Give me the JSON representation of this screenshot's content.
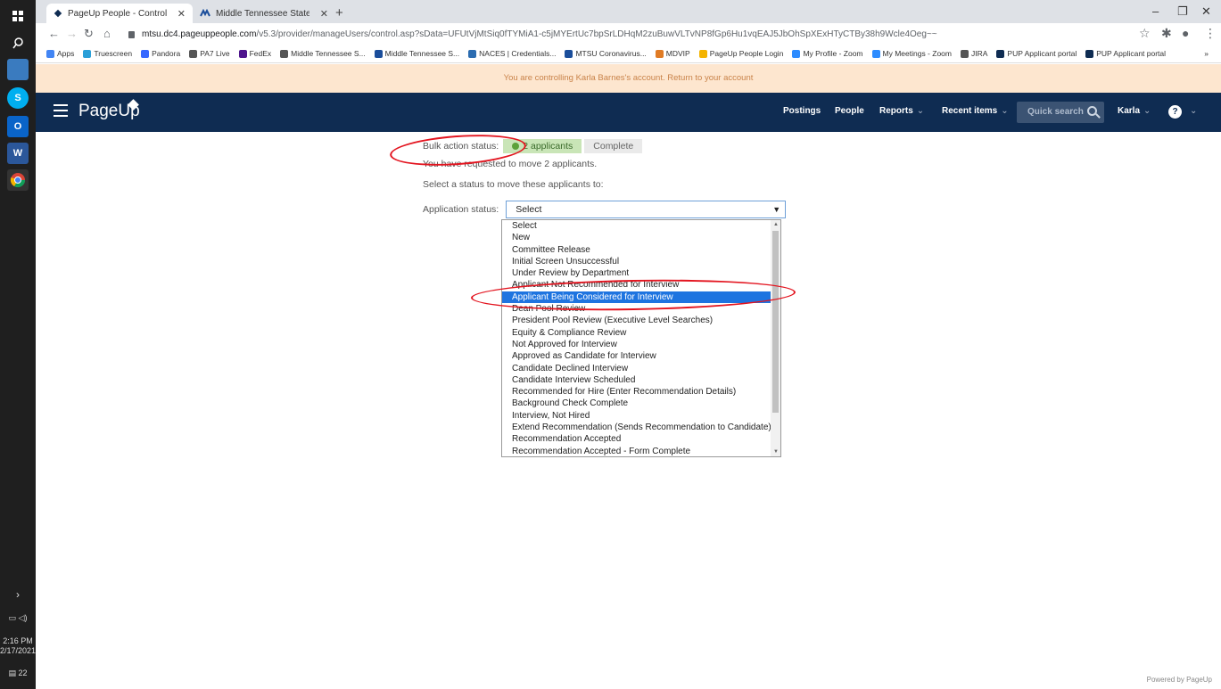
{
  "taskbar": {
    "time": "2:16 PM",
    "date": "2/17/2021",
    "notifications": "22"
  },
  "browser": {
    "tabs": [
      {
        "title": "PageUp People - Control"
      },
      {
        "title": "Middle Tennessee State Universit"
      }
    ],
    "url_host": "mtsu.dc4.pageuppeople.com",
    "url_path": "/v5.3/provider/manageUsers/control.asp?sData=UFUtVjMtSiq0fTYMiA1-c5jMYErtUc7bpSrLDHqM2zuBuwVLTvNP8fGp6Hu1vqEAJ5JbOhSpXExHTyCTBy38h9Wcle4Oeg~~",
    "bookmarks": [
      {
        "label": "Apps",
        "color": "#4285f4"
      },
      {
        "label": "Truescreen",
        "color": "#2a9fd8"
      },
      {
        "label": "Pandora",
        "color": "#3668ff"
      },
      {
        "label": "PA7 Live",
        "color": "#555555"
      },
      {
        "label": "FedEx",
        "color": "#4d148c"
      },
      {
        "label": "Middle Tennessee S...",
        "color": "#555555"
      },
      {
        "label": "Middle Tennessee S...",
        "color": "#1b4e9b"
      },
      {
        "label": "NACES | Credentials...",
        "color": "#2b6cb0"
      },
      {
        "label": "MTSU Coronavirus...",
        "color": "#1b4e9b"
      },
      {
        "label": "MDVIP",
        "color": "#e07b24"
      },
      {
        "label": "PageUp People Login",
        "color": "#f4b400"
      },
      {
        "label": "My Profile - Zoom",
        "color": "#2d8cff"
      },
      {
        "label": "My Meetings - Zoom",
        "color": "#2d8cff"
      },
      {
        "label": "JIRA",
        "color": "#555555"
      },
      {
        "label": "PUP Applicant portal",
        "color": "#0f2c52"
      },
      {
        "label": "PUP Applicant portal",
        "color": "#0f2c52"
      }
    ]
  },
  "banner": {
    "text": "You are controlling Karla Barnes's account.",
    "link": "Return to your account"
  },
  "appbar": {
    "logo": "PageUp",
    "nav": [
      {
        "label": "Postings"
      },
      {
        "label": "People"
      },
      {
        "label": "Reports",
        "chevron": "⌄"
      },
      {
        "label": "Recent items",
        "chevron": "⌄"
      }
    ],
    "quick_search": "Quick search",
    "user": "Karla",
    "help": "?"
  },
  "bulk": {
    "label": "Bulk action status:",
    "step_done": "2 applicants",
    "step_next": "Complete",
    "requested": "You have requested to move 2 applicants.",
    "instruction": "Select a status to move these applicants to:",
    "status_label": "Application status:",
    "selected_value": "Select"
  },
  "dropdown_options": [
    "Select",
    "New",
    "Committee Release",
    "Initial Screen Unsuccessful",
    "Under Review by Department",
    "Applicant Not Recommended for Interview",
    "Applicant Being Considered for Interview",
    "Dean Pool Review",
    "President Pool Review (Executive Level Searches)",
    "Equity & Compliance Review",
    "Not Approved for Interview",
    "Approved as Candidate for Interview",
    "Candidate Declined Interview",
    "Candidate Interview Scheduled",
    "Recommended for Hire (Enter Recommendation Details)",
    "Background Check Complete",
    "Interview, Not Hired",
    "Extend Recommendation (Sends Recommendation to Candidate)",
    "Recommendation Accepted",
    "Recommendation Accepted - Form Complete"
  ],
  "highlighted_option": "Applicant Being Considered for Interview",
  "footer": "Powered by PageUp",
  "colors": {
    "appbar": "#0f2c52",
    "banner": "#fde6cf",
    "highlight": "#1e74e0",
    "annotation": "#e3141f"
  }
}
